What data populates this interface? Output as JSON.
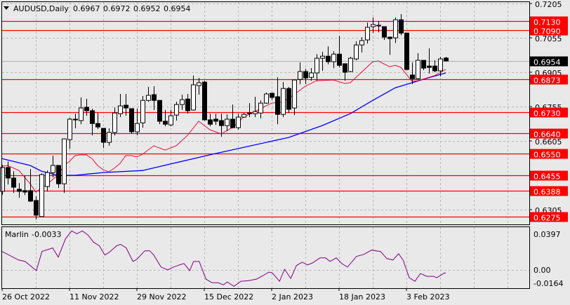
{
  "header": {
    "symbol": "AUDUSD,Daily",
    "open": "0.6967",
    "high": "0.6972",
    "low": "0.6952",
    "close": "0.6954"
  },
  "indicator": {
    "name": "Marlin",
    "value": "-0.0033",
    "axis_labels": [
      "0.0397",
      "0.00",
      "-0.0164"
    ]
  },
  "colors": {
    "background": "#e9e9e9",
    "level": "#ff0000",
    "ma_fast": "#e8103c",
    "ma_slow": "#0000ff",
    "oscillator": "#800080",
    "current_price_bg": "#000000"
  },
  "chart_data": {
    "type": "candlestick",
    "title": "AUDUSD,Daily",
    "ylim": [
      0.6275,
      0.7205
    ],
    "price_ticks": [
      "0.7205",
      "0.7055",
      "0.6905",
      "0.6755",
      "0.6605",
      "0.6305"
    ],
    "grid_prices": [
      0.7205,
      0.7055,
      0.6905,
      0.6755,
      0.6605,
      0.6455,
      0.6305
    ],
    "levels": [
      "0.7130",
      "0.7090",
      "0.6873",
      "0.6730",
      "0.6640",
      "0.6550",
      "0.6455",
      "0.6388",
      "0.6275"
    ],
    "current_price": "0.6954",
    "x_labels": [
      {
        "i": 0,
        "label": "26 Oct 2022"
      },
      {
        "i": 12,
        "label": "11 Nov 2022"
      },
      {
        "i": 24,
        "label": "29 Nov 2022"
      },
      {
        "i": 36,
        "label": "15 Dec 2022"
      },
      {
        "i": 48,
        "label": "2 Jan 2023"
      },
      {
        "i": 60,
        "label": "18 Jan 2023"
      },
      {
        "i": 72,
        "label": "3 Feb 2023"
      }
    ],
    "ohlc": [
      [
        0.6385,
        0.65,
        0.637,
        0.6489
      ],
      [
        0.6489,
        0.6516,
        0.6415,
        0.6443
      ],
      [
        0.6443,
        0.6473,
        0.6378,
        0.6403
      ],
      [
        0.6394,
        0.6421,
        0.6357,
        0.6385
      ],
      [
        0.6388,
        0.6455,
        0.6369,
        0.6382
      ],
      [
        0.6388,
        0.6482,
        0.6339,
        0.6342
      ],
      [
        0.6345,
        0.6363,
        0.6262,
        0.6281
      ],
      [
        0.6275,
        0.6464,
        0.6274,
        0.6458
      ],
      [
        0.6406,
        0.6476,
        0.6385,
        0.6467
      ],
      [
        0.6467,
        0.6541,
        0.6446,
        0.6498
      ],
      [
        0.6498,
        0.65,
        0.64,
        0.6418
      ],
      [
        0.6418,
        0.6616,
        0.6378,
        0.6614
      ],
      [
        0.6611,
        0.6706,
        0.6571,
        0.67
      ],
      [
        0.6697,
        0.6724,
        0.666,
        0.67
      ],
      [
        0.6694,
        0.6795,
        0.6678,
        0.6749
      ],
      [
        0.6752,
        0.6789,
        0.6715,
        0.6737
      ],
      [
        0.6737,
        0.6746,
        0.6629,
        0.6681
      ],
      [
        0.6681,
        0.6727,
        0.6657,
        0.6666
      ],
      [
        0.666,
        0.666,
        0.6574,
        0.6599
      ],
      [
        0.6599,
        0.666,
        0.6584,
        0.6642
      ],
      [
        0.6642,
        0.6751,
        0.6629,
        0.6727
      ],
      [
        0.6724,
        0.681,
        0.6709,
        0.6758
      ],
      [
        0.6761,
        0.681,
        0.6715,
        0.6749
      ],
      [
        0.6746,
        0.6746,
        0.6636,
        0.6645
      ],
      [
        0.6645,
        0.6746,
        0.663,
        0.6681
      ],
      [
        0.6684,
        0.6801,
        0.6663,
        0.6782
      ],
      [
        0.6782,
        0.6841,
        0.6776,
        0.6804
      ],
      [
        0.6807,
        0.6844,
        0.674,
        0.6782
      ],
      [
        0.6782,
        0.6782,
        0.6678,
        0.6691
      ],
      [
        0.6691,
        0.674,
        0.6669,
        0.6678
      ],
      [
        0.6675,
        0.674,
        0.6669,
        0.6715
      ],
      [
        0.6718,
        0.6776,
        0.6694,
        0.6764
      ],
      [
        0.6764,
        0.6807,
        0.674,
        0.6785
      ],
      [
        0.6788,
        0.681,
        0.6724,
        0.6737
      ],
      [
        0.674,
        0.689,
        0.6737,
        0.685
      ],
      [
        0.6847,
        0.688,
        0.6807,
        0.6859
      ],
      [
        0.6862,
        0.6868,
        0.6694,
        0.6697
      ],
      [
        0.6697,
        0.6724,
        0.6669,
        0.6678
      ],
      [
        0.67,
        0.6724,
        0.6675,
        0.6691
      ],
      [
        0.6694,
        0.6724,
        0.6623,
        0.6672
      ],
      [
        0.6672,
        0.6721,
        0.6648,
        0.67
      ],
      [
        0.67,
        0.6764,
        0.666,
        0.6663
      ],
      [
        0.6663,
        0.6724,
        0.6654,
        0.6709
      ],
      [
        0.6709,
        0.6727,
        0.6706,
        0.6721
      ],
      [
        0.6724,
        0.677,
        0.6709,
        0.6727
      ],
      [
        0.6724,
        0.6798,
        0.6709,
        0.6733
      ],
      [
        0.6727,
        0.6782,
        0.6703,
        0.677
      ],
      [
        0.677,
        0.6816,
        0.6767,
        0.681
      ],
      [
        0.6813,
        0.6816,
        0.6785,
        0.6795
      ],
      [
        0.6798,
        0.6883,
        0.6678,
        0.6721
      ],
      [
        0.6721,
        0.6862,
        0.6709,
        0.6834
      ],
      [
        0.6834,
        0.6841,
        0.6727,
        0.6743
      ],
      [
        0.6749,
        0.6871,
        0.6718,
        0.6871
      ],
      [
        0.6874,
        0.6948,
        0.6853,
        0.6908
      ],
      [
        0.6908,
        0.692,
        0.6853,
        0.688
      ],
      [
        0.6883,
        0.6923,
        0.6868,
        0.6902
      ],
      [
        0.6902,
        0.6984,
        0.6868,
        0.6966
      ],
      [
        0.6966,
        0.6994,
        0.6911,
        0.6975
      ],
      [
        0.6975,
        0.7018,
        0.6939,
        0.6951
      ],
      [
        0.6951,
        0.6997,
        0.6923,
        0.6984
      ],
      [
        0.6984,
        0.7064,
        0.6926,
        0.6935
      ],
      [
        0.6942,
        0.6942,
        0.6868,
        0.6905
      ],
      [
        0.6908,
        0.6972,
        0.6905,
        0.6966
      ],
      [
        0.6963,
        0.704,
        0.6957,
        0.7024
      ],
      [
        0.7024,
        0.7058,
        0.6991,
        0.7043
      ],
      [
        0.7046,
        0.7122,
        0.703,
        0.7101
      ],
      [
        0.7104,
        0.7144,
        0.7076,
        0.7113
      ],
      [
        0.711,
        0.7128,
        0.7079,
        0.7107
      ],
      [
        0.7104,
        0.7104,
        0.7046,
        0.7058
      ],
      [
        0.7058,
        0.7061,
        0.6981,
        0.7052
      ],
      [
        0.7055,
        0.7144,
        0.7033,
        0.7134
      ],
      [
        0.7134,
        0.7159,
        0.7067,
        0.7076
      ],
      [
        0.7076,
        0.7076,
        0.6914,
        0.6917
      ],
      [
        0.6893,
        0.6948,
        0.6853,
        0.6877
      ],
      [
        0.6877,
        0.6988,
        0.6874,
        0.6957
      ],
      [
        0.6957,
        0.6957,
        0.6914,
        0.6923
      ],
      [
        0.6932,
        0.7009,
        0.6899,
        0.6926
      ],
      [
        0.6932,
        0.6957,
        0.6905,
        0.6911
      ],
      [
        0.6911,
        0.6972,
        0.6887,
        0.6963
      ],
      [
        0.6967,
        0.6972,
        0.6952,
        0.6954
      ]
    ],
    "ma_fast": [
      [
        0,
        0.6495
      ],
      [
        1,
        0.6498
      ],
      [
        3,
        0.6476
      ],
      [
        5,
        0.6418
      ],
      [
        6,
        0.6382
      ],
      [
        7,
        0.64
      ],
      [
        8,
        0.6415
      ],
      [
        9,
        0.6437
      ],
      [
        10,
        0.6455
      ],
      [
        11,
        0.6498
      ],
      [
        12,
        0.6516
      ],
      [
        13,
        0.6541
      ],
      [
        14,
        0.6544
      ],
      [
        15,
        0.6544
      ],
      [
        16,
        0.6528
      ],
      [
        17,
        0.6498
      ],
      [
        18,
        0.6479
      ],
      [
        19,
        0.647
      ],
      [
        20,
        0.6486
      ],
      [
        21,
        0.6507
      ],
      [
        22,
        0.6541
      ],
      [
        23,
        0.6541
      ],
      [
        24,
        0.6535
      ],
      [
        25,
        0.6547
      ],
      [
        27,
        0.6584
      ],
      [
        29,
        0.6565
      ],
      [
        31,
        0.6584
      ],
      [
        33,
        0.6629
      ],
      [
        35,
        0.6691
      ],
      [
        37,
        0.6654
      ],
      [
        39,
        0.6636
      ],
      [
        41,
        0.6663
      ],
      [
        43,
        0.6709
      ],
      [
        46,
        0.6746
      ],
      [
        48,
        0.677
      ],
      [
        50,
        0.6776
      ],
      [
        52,
        0.6807
      ],
      [
        54,
        0.6844
      ],
      [
        56,
        0.6868
      ],
      [
        59,
        0.6871
      ],
      [
        61,
        0.6856
      ],
      [
        62,
        0.6859
      ],
      [
        64,
        0.6905
      ],
      [
        66,
        0.6951
      ],
      [
        67,
        0.6954
      ],
      [
        69,
        0.6929
      ],
      [
        70,
        0.6935
      ],
      [
        71,
        0.6926
      ],
      [
        73,
        0.6865
      ],
      [
        74,
        0.6868
      ],
      [
        77,
        0.689
      ],
      [
        79,
        0.6917
      ]
    ],
    "ma_slow": [
      [
        0,
        0.6528
      ],
      [
        5,
        0.6498
      ],
      [
        7,
        0.6473
      ],
      [
        10,
        0.6455
      ],
      [
        13,
        0.6455
      ],
      [
        18,
        0.6467
      ],
      [
        25,
        0.6476
      ],
      [
        38,
        0.655
      ],
      [
        51,
        0.662
      ],
      [
        57,
        0.6672
      ],
      [
        62,
        0.6724
      ],
      [
        66,
        0.6782
      ],
      [
        70,
        0.6837
      ],
      [
        73,
        0.6859
      ],
      [
        75,
        0.6874
      ],
      [
        79,
        0.6902
      ]
    ],
    "oscillator": {
      "name": "Marlin",
      "ylim": [
        -0.0164,
        0.0397
      ],
      "points": [
        [
          0,
          0.018
        ],
        [
          2.9,
          0.0097
        ],
        [
          4.1,
          0.0083
        ],
        [
          6.1,
          -0.0007
        ],
        [
          7.1,
          0.018
        ],
        [
          9,
          0.0215
        ],
        [
          10,
          0.0125
        ],
        [
          11.3,
          0.0305
        ],
        [
          12.4,
          0.0381
        ],
        [
          13.3,
          0.0353
        ],
        [
          14.3,
          0.0381
        ],
        [
          15.3,
          0.034
        ],
        [
          16.3,
          0.027
        ],
        [
          17.3,
          0.0236
        ],
        [
          18.3,
          0.0146
        ],
        [
          19.1,
          0.0173
        ],
        [
          20.4,
          0.0236
        ],
        [
          21.1,
          0.025
        ],
        [
          22.1,
          0.0215
        ],
        [
          23.3,
          0.0083
        ],
        [
          24,
          0.0104
        ],
        [
          25.4,
          0.0187
        ],
        [
          26.3,
          0.0187
        ],
        [
          27,
          0.0146
        ],
        [
          28.3,
          0.0028
        ],
        [
          29.5,
          0
        ],
        [
          30.5,
          0.0028
        ],
        [
          31.9,
          0.0055
        ],
        [
          32.4,
          0.0062
        ],
        [
          33.4,
          -0.0007
        ],
        [
          34.1,
          0.0083
        ],
        [
          35.1,
          0.0083
        ],
        [
          36.3,
          -0.009
        ],
        [
          37.4,
          -0.0125
        ],
        [
          38.5,
          -0.0125
        ],
        [
          39.4,
          -0.0146
        ],
        [
          40.1,
          -0.0118
        ],
        [
          41.3,
          -0.016
        ],
        [
          42.5,
          -0.0111
        ],
        [
          43.9,
          -0.0104
        ],
        [
          45.3,
          -0.009
        ],
        [
          46.5,
          -0.0055
        ],
        [
          47.5,
          -0.0021
        ],
        [
          48.1,
          -0.0028
        ],
        [
          49.4,
          -0.0111
        ],
        [
          50.3,
          0.0007
        ],
        [
          51.4,
          -0.0083
        ],
        [
          52.4,
          0.0042
        ],
        [
          53.4,
          0.0076
        ],
        [
          54.4,
          0.0049
        ],
        [
          55.3,
          0.0069
        ],
        [
          56.6,
          0.0118
        ],
        [
          57.6,
          0.0118
        ],
        [
          58.4,
          0.0083
        ],
        [
          59.5,
          0.0118
        ],
        [
          60.5,
          0.0062
        ],
        [
          61.5,
          0.0028
        ],
        [
          63.1,
          0.0132
        ],
        [
          64.4,
          0.0152
        ],
        [
          65.8,
          0.0194
        ],
        [
          67.4,
          0.018
        ],
        [
          68.5,
          0.0111
        ],
        [
          69.6,
          0.0097
        ],
        [
          70.6,
          0.0159
        ],
        [
          71.4,
          0.0097
        ],
        [
          72.5,
          -0.0076
        ],
        [
          73.5,
          -0.0111
        ],
        [
          74.5,
          -0.0035
        ],
        [
          75.6,
          -0.0062
        ],
        [
          76.8,
          -0.0062
        ],
        [
          77.4,
          -0.0076
        ],
        [
          78.8,
          -0.0028
        ],
        [
          79,
          -0.0033
        ]
      ]
    }
  }
}
